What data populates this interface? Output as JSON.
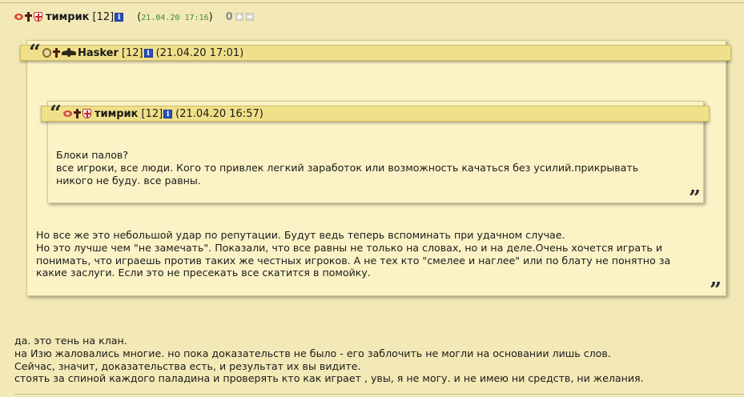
{
  "post": {
    "author": "тимрик",
    "level": "[12]",
    "date": "21.04.20 17:16",
    "date_open": "(",
    "date_close": ")",
    "score": "0",
    "badges": [
      "wing-badge-icon",
      "cross-badge-icon",
      "shield-badge-icon"
    ]
  },
  "outer_quote": {
    "author": "Hasker",
    "level": "[12]",
    "date": "(21.04.20 17:01)",
    "open_mark": "“",
    "close_mark": "”",
    "lines": [
      "Но все же это небольшой удар по репутации. Будут ведь теперь вспоминать при удачном случае.",
      "Но это лучше чем \"не замечать\". Показали, что все равны не только на словах, но и на деле.Очень хочется играть и",
      "понимать, что играешь против таких же честных игроков. А не тех кто \"смелее и наглее\" или по блату не понятно за",
      "какие заслуги. Если это не пресекать все скатится в помойку."
    ]
  },
  "inner_quote": {
    "author": "тимрик",
    "level": "[12]",
    "date": "(21.04.20 16:57)",
    "open_mark": "“",
    "close_mark": "”",
    "lines": [
      "Блоки палов?",
      "все игроки, все люди. Кого то привлек легкий заработок или возможность качаться без усилий.прикрывать",
      "никого не буду. все равны."
    ]
  },
  "reply": {
    "lines": [
      "да. это тень на клан.",
      "на Изю жаловались многие. но пока доказательств не было - его заблочить не могли на основании лишь слов.",
      "Сейчас, значит, доказательства есть, и результат их вы видите.",
      "стоять за спиной каждого паладина и проверять кто как играет , увы, я не могу. и не имею ни средств, ни желания."
    ]
  },
  "info_icon_label": "i",
  "colors": {
    "background": "#f3e9b6",
    "quote_bg": "#fbf3c6",
    "quote_bar": "#f0e08a",
    "date_green": "#3f8a3f",
    "info_blue": "#2a50c0"
  }
}
